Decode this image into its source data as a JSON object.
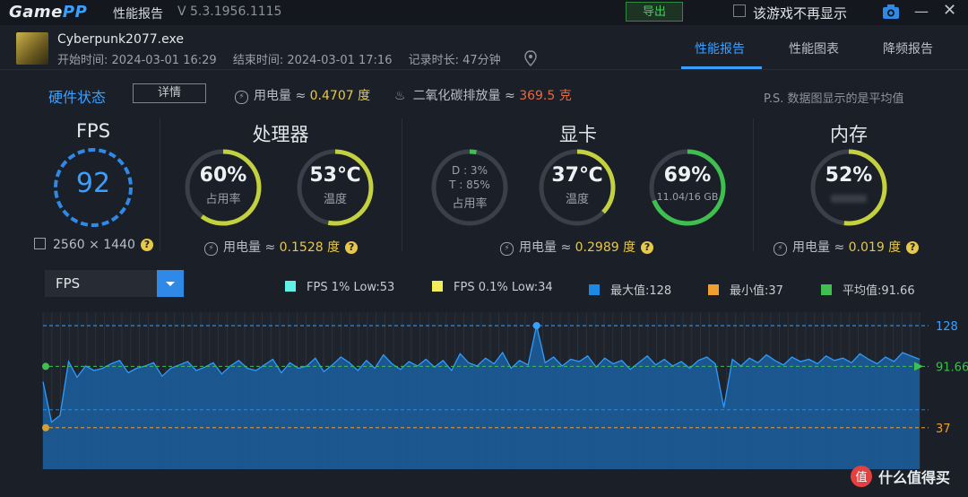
{
  "app": {
    "logo_main": "Game",
    "logo_accent": "PP",
    "title": "性能报告",
    "version": "V 5.3.1956.1115"
  },
  "window": {
    "export_label": "导出",
    "hide_game_label": "该游戏不再显示"
  },
  "game": {
    "exe": "Cyberpunk2077.exe",
    "start": "开始时间: 2024-03-01 16:29",
    "end": "结束时间: 2024-03-01 17:16",
    "duration": "记录时长: 47分钟"
  },
  "tabs": [
    "性能报告",
    "性能图表",
    "降频报告"
  ],
  "status": {
    "title": "硬件状态",
    "detail_button": "详情",
    "power_label": "用电量 ≈ ",
    "power_value": "0.4707 度",
    "co2_label": "二氧化碳排放量 ≈ ",
    "co2_value": "369.5 克",
    "note": "P.S. 数据图显示的是平均值"
  },
  "fps_section": {
    "title": "FPS",
    "value": "92",
    "resolution": "2560 × 1440"
  },
  "cpu_section": {
    "title": "处理器",
    "usage": {
      "value": "60%",
      "label": "占用率",
      "fraction": 0.6
    },
    "temp": {
      "value": "53℃",
      "label": "温度",
      "fraction": 0.53
    },
    "power_label": "用电量 ≈ ",
    "power_value": "0.1528 度"
  },
  "gpu_section": {
    "title": "显卡",
    "usage": {
      "line1": "D : 3%",
      "line2": "T : 85%",
      "label": "占用率",
      "fraction": 0.03
    },
    "temp": {
      "value": "37℃",
      "label": "温度",
      "fraction": 0.37
    },
    "vram": {
      "value": "69%",
      "label": "11.04/16 GB",
      "fraction": 0.69
    },
    "power_label": "用电量 ≈ ",
    "power_value": "0.2989 度"
  },
  "mem_section": {
    "title": "内存",
    "usage": {
      "value": "52%",
      "fraction": 0.52
    },
    "power_label": "用电量 ≈ ",
    "power_value": "0.019 度"
  },
  "metric_select": {
    "value": "FPS"
  },
  "legend": [
    {
      "label": "FPS 1% Low:53",
      "color": "#5ef2e6"
    },
    {
      "label": "FPS 0.1% Low:34",
      "color": "#f2ec5a"
    },
    {
      "label": "最大值:128",
      "color": "#1e88e5"
    },
    {
      "label": "最小值:37",
      "color": "#f0a030"
    },
    {
      "label": "平均值:91.66",
      "color": "#3fbf4f"
    }
  ],
  "chart_data": {
    "type": "area",
    "series": [
      {
        "name": "FPS",
        "values": [
          78,
          42,
          48,
          96,
          82,
          92,
          88,
          90,
          94,
          97,
          86,
          90,
          92,
          95,
          83,
          90,
          93,
          96,
          88,
          91,
          95,
          85,
          92,
          97,
          90,
          88,
          93,
          98,
          86,
          95,
          90,
          92,
          99,
          87,
          93,
          100,
          95,
          88,
          97,
          90,
          102,
          94,
          89,
          96,
          92,
          98,
          91,
          97,
          88,
          103,
          95,
          92,
          99,
          94,
          104,
          90,
          97,
          93,
          128,
          95,
          100,
          92,
          98,
          96,
          101,
          91,
          99,
          94,
          97,
          89,
          95,
          101,
          93,
          98,
          92,
          96,
          90,
          97,
          100,
          94,
          55,
          98,
          92,
          99,
          95,
          102,
          97,
          93,
          100,
          96,
          98,
          94,
          101,
          97,
          99,
          95,
          103,
          98,
          94,
          100,
          96,
          104,
          101,
          98
        ]
      }
    ],
    "max": 128,
    "min": 37,
    "avg": 91.66,
    "reference_lines": [
      {
        "label": "128",
        "value": 128,
        "color": "#3aa0ff"
      },
      {
        "label": "91.66",
        "value": 91.66,
        "color": "#3fbf4f"
      },
      {
        "label": "37",
        "value": 37,
        "color": "#f0a030"
      }
    ],
    "ylim": [
      0,
      140
    ],
    "grid": true
  },
  "watermark": {
    "text": "什么值得买",
    "icon_glyph": "值"
  }
}
